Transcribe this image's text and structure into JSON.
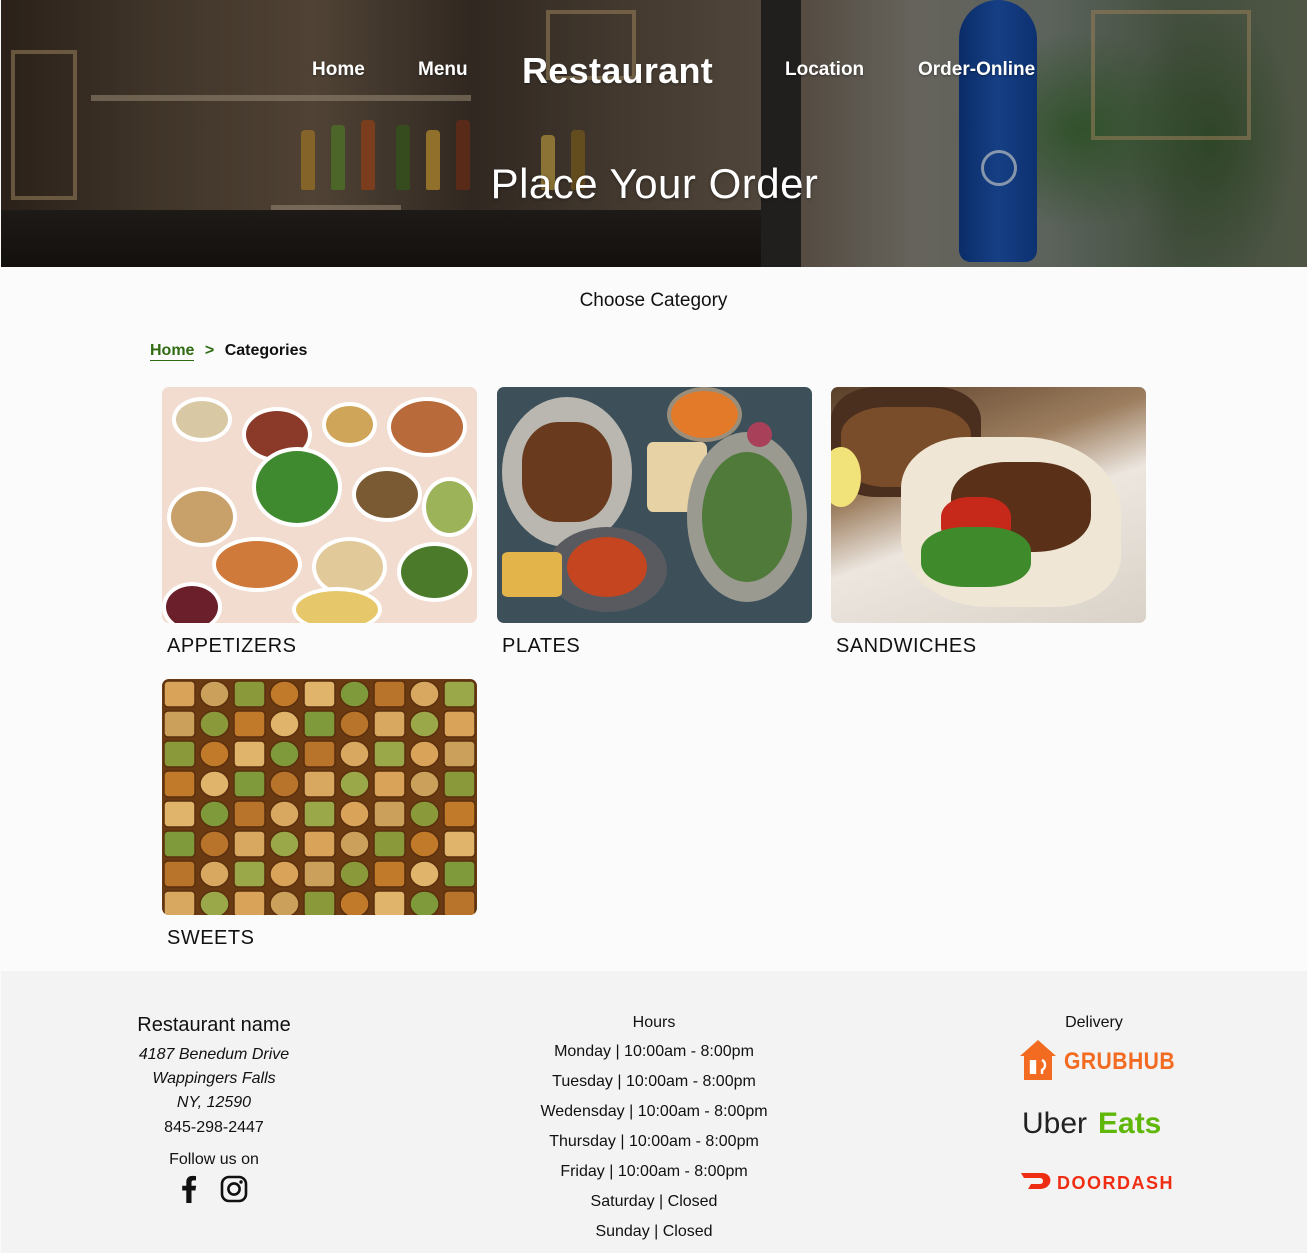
{
  "nav": {
    "home": "Home",
    "menu": "Menu",
    "brand": "Restaurant",
    "location": "Location",
    "order_online": "Order-Online"
  },
  "hero": {
    "title": "Place Your Order"
  },
  "section": {
    "heading": "Choose Category"
  },
  "breadcrumb": {
    "home": "Home",
    "separator": ">",
    "current": "Categories"
  },
  "categories": [
    {
      "label": "APPETIZERS"
    },
    {
      "label": "PLATES"
    },
    {
      "label": "SANDWICHES"
    },
    {
      "label": "SWEETS"
    }
  ],
  "footer": {
    "restaurant_name": "Restaurant name",
    "address_line1": "4187 Benedum Drive",
    "address_line2": "Wappingers Falls",
    "address_line3": "NY, 12590",
    "phone": "845-298-2447",
    "follow": "Follow us on",
    "hours_title": "Hours",
    "hours": [
      "Monday | 10:00am - 8:00pm",
      "Tuesday | 10:00am - 8:00pm",
      "Wedensday | 10:00am - 8:00pm",
      "Thursday | 10:00am - 8:00pm",
      "Friday | 10:00am - 8:00pm",
      "Saturday | Closed",
      "Sunday | Closed"
    ],
    "delivery_title": "Delivery",
    "delivery": {
      "grubhub": "GRUBHUB",
      "uber": "Uber",
      "eats": "Eats",
      "doordash": "DOORDASH"
    }
  },
  "colors": {
    "breadcrumb_green": "#2f6b12",
    "grubhub_orange": "#f26b21",
    "uber_green": "#5fb709",
    "doordash_red": "#ef2d12",
    "footer_bg": "#f3f3f3"
  }
}
